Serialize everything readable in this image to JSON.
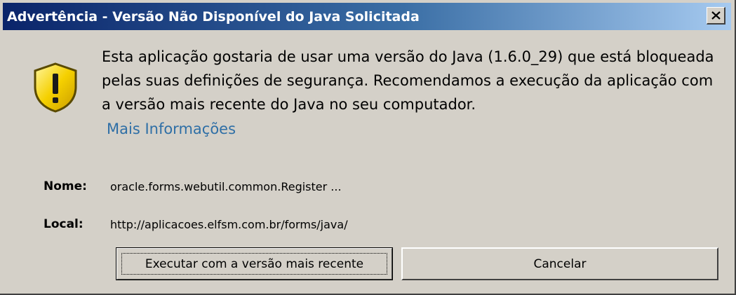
{
  "window": {
    "title": "Advertência - Versão Não Disponível do Java Solicitada"
  },
  "message": {
    "text": "Esta aplicação gostaria de usar uma versão do Java (1.6.0_29) que está bloqueada pelas suas definições de segurança. Recomendamos a execução da aplicação com a versão mais recente do Java no seu computador.",
    "more_info_link": "Mais Informações"
  },
  "details": {
    "name_label": "Nome:",
    "name_value": "oracle.forms.webutil.common.Register ...",
    "location_label": "Local:",
    "location_value": "http://aplicacoes.elfsm.com.br/forms/java/"
  },
  "buttons": {
    "run_latest": "Executar com a versão mais recente",
    "cancel": "Cancelar"
  },
  "colors": {
    "titlebar_start": "#0a246a",
    "titlebar_end": "#a6caf0",
    "link": "#2f6fa6",
    "dialog_bg": "#d4d0c8",
    "warning_yellow": "#f5d000"
  },
  "icons": {
    "warning": "warning-shield-icon",
    "close": "close-icon"
  }
}
